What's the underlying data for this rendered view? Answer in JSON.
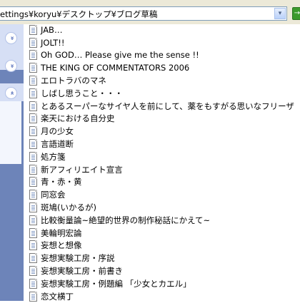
{
  "address_bar": {
    "path": "ettings¥koryu¥デスクトップ¥ブログ草稿",
    "dropdown_glyph": "▾",
    "go_glyph": "→"
  },
  "task_pane": {
    "sections": [
      {
        "toggle": "»",
        "state": "collapsed"
      },
      {
        "toggle": "»",
        "state": "collapsed"
      },
      {
        "toggle": "«",
        "state": "expanded"
      }
    ]
  },
  "files": [
    "JAB…",
    "JOLT!!",
    "Oh GOD… Please give me the sense !!",
    "THE KING OF COMMENTATORS 2006",
    "エロトラバのマネ",
    "しばし思うこと・・・",
    "とあるスーパーなサイヤ人を前にして、薬をもすがる思いなフリーザ",
    "楽天における自分史",
    "月の少女",
    "言語道断",
    "処方箋",
    "新アフィリエイト宣言",
    "青・赤・黄",
    "同窓会",
    "斑鳩(いかるが)",
    "比較衡量論~絶望的世界の制作秘話にかえて~",
    "美輪明宏論",
    "妄想と想像",
    "妄想実験工房・序説",
    "妄想実験工房・前書き",
    "妄想実験工房・例題編 「少女とカエル」",
    "恋文横丁"
  ]
}
